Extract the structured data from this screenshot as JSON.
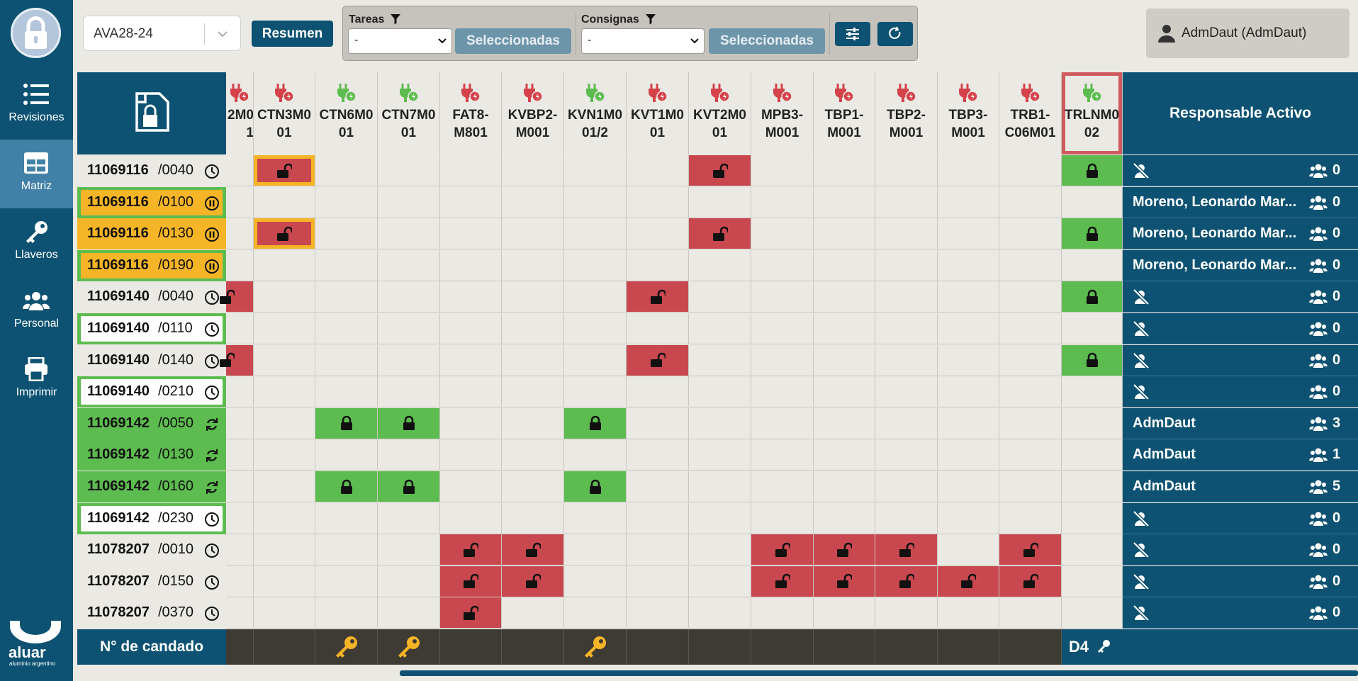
{
  "nav": {
    "items": [
      {
        "label": "Revisiones",
        "icon": "list-icon"
      },
      {
        "label": "Matriz",
        "icon": "grid-icon"
      },
      {
        "label": "Llaveros",
        "icon": "key-icon"
      },
      {
        "label": "Personal",
        "icon": "people-icon"
      },
      {
        "label": "Imprimir",
        "icon": "printer-icon"
      }
    ],
    "brand": {
      "name": "aluar",
      "tagline": "aluminio argentino"
    }
  },
  "toolbar": {
    "project": "AVA28-24",
    "summary_label": "Resumen",
    "tareas_label": "Tareas",
    "tareas_value": "-",
    "tareas_btn": "Seleccionadas",
    "consignas_label": "Consignas",
    "consignas_value": "-",
    "consignas_btn": "Seleccionadas"
  },
  "user": {
    "name": "AdmDaut (AdmDaut)"
  },
  "matrix": {
    "columns": [
      {
        "label": "2M0\n1",
        "plug": "red"
      },
      {
        "label": "CTN3M0\n01",
        "plug": "red"
      },
      {
        "label": "CTN6M0\n01",
        "plug": "green"
      },
      {
        "label": "CTN7M0\n01",
        "plug": "green"
      },
      {
        "label": "FAT8-\nM801",
        "plug": "red"
      },
      {
        "label": "KVBP2-\nM001",
        "plug": "red"
      },
      {
        "label": "KVN1M0\n01/2",
        "plug": "green"
      },
      {
        "label": "KVT1M0\n01",
        "plug": "red"
      },
      {
        "label": "KVT2M0\n01",
        "plug": "red"
      },
      {
        "label": "MPB3-\nM001",
        "plug": "red"
      },
      {
        "label": "TBP1-\nM001",
        "plug": "red"
      },
      {
        "label": "TBP2-\nM001",
        "plug": "red"
      },
      {
        "label": "TBP3-\nM001",
        "plug": "red"
      },
      {
        "label": "TRB1-\nC06M01",
        "plug": "red"
      },
      {
        "label": "TRLNM0\n02",
        "plug": "green",
        "selected": true
      }
    ],
    "responsable_header": "Responsable Activo",
    "rows": [
      {
        "num": "11069116",
        "sub": "/0040",
        "status": "clock",
        "bg": "#ebe9e4",
        "pill": "#ebe9e4",
        "resp": "",
        "count": "0",
        "cells": {
          "1": "red-open-hl",
          "8": "red-open",
          "14": "green-locked"
        }
      },
      {
        "num": "11069116",
        "sub": "/0100",
        "status": "pause",
        "bg": "#5dbc4f",
        "pill": "#f5b526",
        "resp": "Moreno, Leonardo Mar...",
        "count": "0",
        "cells": {}
      },
      {
        "num": "11069116",
        "sub": "/0130",
        "status": "pause",
        "bg": "#f5b526",
        "pill": "#f5b526",
        "resp": "Moreno, Leonardo Mar...",
        "count": "0",
        "cells": {
          "1": "red-open-hl",
          "8": "red-open",
          "14": "green-locked"
        }
      },
      {
        "num": "11069116",
        "sub": "/0190",
        "status": "pause",
        "bg": "#5dbc4f",
        "pill": "#f5b526",
        "resp": "Moreno, Leonardo Mar...",
        "count": "0",
        "cells": {}
      },
      {
        "num": "11069140",
        "sub": "/0040",
        "status": "clock",
        "bg": "#ebe9e4",
        "pill": "#ebe9e4",
        "resp": "",
        "count": "0",
        "cells": {
          "0": "red-open-edge",
          "7": "red-open",
          "14": "green-locked"
        }
      },
      {
        "num": "11069140",
        "sub": "/0110",
        "status": "clock",
        "bg": "#5dbc4f",
        "pill": "#ffffff",
        "resp": "",
        "count": "0",
        "cells": {}
      },
      {
        "num": "11069140",
        "sub": "/0140",
        "status": "clock",
        "bg": "#ebe9e4",
        "pill": "#ebe9e4",
        "resp": "",
        "count": "0",
        "cells": {
          "0": "red-open-edge",
          "7": "red-open",
          "14": "green-locked"
        }
      },
      {
        "num": "11069140",
        "sub": "/0210",
        "status": "clock",
        "bg": "#5dbc4f",
        "pill": "#ffffff",
        "resp": "",
        "count": "0",
        "cells": {}
      },
      {
        "num": "11069142",
        "sub": "/0050",
        "status": "sync",
        "bg": "#5dbc4f",
        "pill": "#5dbc4f",
        "resp": "AdmDaut",
        "count": "3",
        "cells": {
          "2": "green-locked",
          "3": "green-locked",
          "6": "green-locked"
        }
      },
      {
        "num": "11069142",
        "sub": "/0130",
        "status": "sync",
        "bg": "#5dbc4f",
        "pill": "#5dbc4f",
        "resp": "AdmDaut",
        "count": "1",
        "cells": {}
      },
      {
        "num": "11069142",
        "sub": "/0160",
        "status": "sync",
        "bg": "#5dbc4f",
        "pill": "#5dbc4f",
        "resp": "AdmDaut",
        "count": "5",
        "cells": {
          "2": "green-locked",
          "3": "green-locked",
          "6": "green-locked"
        }
      },
      {
        "num": "11069142",
        "sub": "/0230",
        "status": "clock",
        "bg": "#5dbc4f",
        "pill": "#ffffff",
        "resp": "",
        "count": "0",
        "cells": {}
      },
      {
        "num": "11078207",
        "sub": "/0010",
        "status": "clock",
        "bg": "#ebe9e4",
        "pill": "#ebe9e4",
        "resp": "",
        "count": "0",
        "cells": {
          "4": "red-open",
          "5": "red-open",
          "9": "red-open",
          "10": "red-open",
          "11": "red-open",
          "13": "red-open"
        }
      },
      {
        "num": "11078207",
        "sub": "/0150",
        "status": "clock",
        "bg": "#ebe9e4",
        "pill": "#ebe9e4",
        "resp": "",
        "count": "0",
        "cells": {
          "4": "red-open",
          "5": "red-open",
          "9": "red-open",
          "10": "red-open",
          "11": "red-open",
          "12": "red-open",
          "13": "red-open"
        }
      },
      {
        "num": "11078207",
        "sub": "/0370",
        "status": "clock",
        "bg": "#ebe9e4",
        "pill": "#ebe9e4",
        "resp": "",
        "count": "0",
        "cells": {
          "4": "red-open"
        }
      }
    ],
    "footer": {
      "label": "N° de candado",
      "keys": [
        2,
        3,
        6
      ],
      "padlock_no": "D4"
    }
  },
  "colors": {
    "primary": "#0d5272",
    "red": "#c9484f",
    "green": "#5dbc4f",
    "amber": "#f5b526",
    "bg": "#ebe9e4"
  }
}
